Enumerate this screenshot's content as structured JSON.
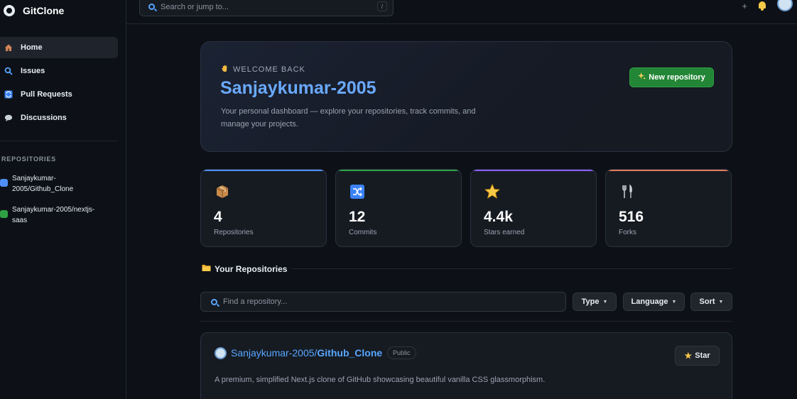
{
  "app": {
    "name": "GitClone"
  },
  "search": {
    "placeholder": "Search or jump to...",
    "shortcut": "/"
  },
  "topbar": {
    "plus_label": "+"
  },
  "nav": [
    {
      "id": "home",
      "label": "Home",
      "icon": "house-icon",
      "active": true
    },
    {
      "id": "issues",
      "label": "Issues",
      "icon": "magnifier-icon",
      "active": false
    },
    {
      "id": "pulls",
      "label": "Pull Requests",
      "icon": "merge-icon",
      "active": false
    },
    {
      "id": "discussions",
      "label": "Discussions",
      "icon": "speech-bubble-icon",
      "active": false
    }
  ],
  "sidebar_repos": {
    "heading": "REPOSITORIES",
    "items": [
      {
        "label": "Sanjaykumar-2005/Github_Clone",
        "color": "#4f8ff7"
      },
      {
        "label": "Sanjaykumar-2005/nextjs-saas",
        "color": "#2ea043"
      }
    ]
  },
  "hero": {
    "kicker": "WELCOME BACK",
    "title": "Sanjaykumar-2005",
    "description": "Your personal dashboard — explore your repositories, track commits, and manage your projects.",
    "new_repo_label": "New repository"
  },
  "stats": [
    {
      "value": "4",
      "label": "Repositories",
      "icon": "package-icon",
      "accent": "#4f8ff7"
    },
    {
      "value": "12",
      "label": "Commits",
      "icon": "shuffle-icon",
      "accent": "#2ea043"
    },
    {
      "value": "4.4k",
      "label": "Stars earned",
      "icon": "star-icon",
      "accent": "#8b5cf6"
    },
    {
      "value": "516",
      "label": "Forks",
      "icon": "fork-knife-icon",
      "accent": "#e07a5f"
    }
  ],
  "repos_section": {
    "title": "Your Repositories",
    "find_placeholder": "Find a repository...",
    "filters": {
      "type": "Type",
      "language": "Language",
      "sort": "Sort"
    }
  },
  "repo_card": {
    "owner": "Sanjaykumar-2005/",
    "name": "Github_Clone",
    "visibility": "Public",
    "star_label": "Star",
    "description": "A premium, simplified Next.js clone of GitHub showcasing beautiful vanilla CSS glassmorphism."
  }
}
